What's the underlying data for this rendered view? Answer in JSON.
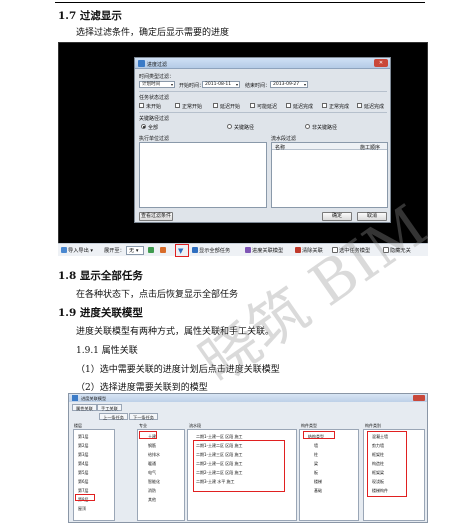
{
  "doc": {
    "s17_heading": "1.7 过滤显示",
    "s17_para": "选择过滤条件，确定后显示需要的进度",
    "s18_heading": "1.8 显示全部任务",
    "s18_para": "在各种状态下，点击后恢复显示全部任务",
    "s19_heading": "1.9 进度关联模型",
    "s19_para": "进度关联模型有两种方式，属性关联和手工关联。",
    "s191_heading": "1.9.1 属性关联",
    "step1": "（1）选中需要关联的进度计划后点击进度关联模型",
    "step2": "（2）选择进度需要关联到的模型"
  },
  "dialog": {
    "title": "进度过滤",
    "time_type_label": "时间类型过滤：",
    "time_type_value": "计划时间",
    "start_label": "开始时间：",
    "start_value": "2011-08-11",
    "end_label": "结束时间：",
    "end_value": "2013-09-27",
    "status_label": "任务状态过滤",
    "status_options": [
      "未开始",
      "正常开始",
      "延迟开始",
      "可能延迟",
      "延迟完成",
      "正常完成",
      "延迟完成"
    ],
    "path_label": "关键路径过滤",
    "path_options": [
      "全部",
      "关键路径",
      "非关键路径"
    ],
    "unit_label": "执行单位过滤",
    "flow_label": "流水段过滤",
    "col_name": "名称",
    "col_order": "施工顺序",
    "view_btn": "查看过滤条件",
    "ok_btn": "确定",
    "cancel_btn": "取消"
  },
  "toolbar": {
    "import_export": "导入导出",
    "expand_label": "展开至：",
    "expand_value": "无",
    "show_all": "显示全部任务",
    "link_model": "进度关联模型",
    "unlink": "清除关联",
    "selected_only": "选中任务模型",
    "hide_unrelated": "隐藏无关"
  },
  "shot2": {
    "title": "进度关联模型",
    "tabs": [
      "属性关联",
      "手工关联"
    ],
    "sub_tabs": [
      "上一条任务",
      "下一条任务"
    ],
    "col_floor": "楼层",
    "col_major": "专业",
    "col_flow": "流水段",
    "col_type": "构件类型",
    "col_cat": "构件类别",
    "floors": [
      "第1层",
      "第2层",
      "第3层",
      "第4层",
      "第5层",
      "第6层",
      "第7层",
      "第8层",
      "屋顶"
    ],
    "floors_checked": "第8层",
    "majors": [
      "土建",
      "钢筋",
      "给排水",
      "暖通",
      "电气",
      "智能化",
      "消防",
      "其他"
    ],
    "flows": [
      "二期1-土建一区 区段 施工",
      "二期1-土建二区 区段 施工",
      "二期1-土建三区 区段 施工",
      "二期2-土建一区 区段 施工",
      "二期2-土建二区 区段 施工",
      "二期3-土建 水平 施工"
    ],
    "types": [
      "结构类型",
      "墙",
      "柱",
      "梁",
      "板",
      "楼梯",
      "基础"
    ],
    "cats": [
      "混凝土墙",
      "剪力墙",
      "框架柱",
      "构造柱",
      "框架梁",
      "现浇板",
      "楼梯构件"
    ]
  },
  "watermark": "晓筑 BIM"
}
